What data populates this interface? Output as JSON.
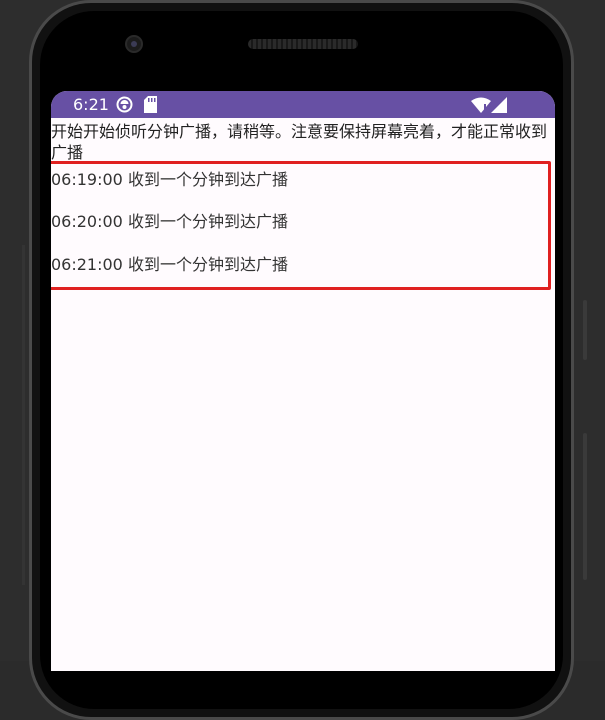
{
  "status_bar": {
    "time": "6:21",
    "icons": [
      "sync-icon",
      "sd-card-icon",
      "wifi-icon",
      "signal-icon"
    ],
    "color": "#6750a4"
  },
  "app": {
    "notice": "开始开始侦听分钟广播，请稍等。注意要保持屏幕亮着，才能正常收到广播",
    "log_lines": [
      "06:19:00 收到一个分钟到达广播",
      "06:20:00 收到一个分钟到达广播",
      "06:21:00 收到一个分钟到达广播"
    ],
    "highlight_color": "#e02020",
    "background": "#fffbfe"
  }
}
